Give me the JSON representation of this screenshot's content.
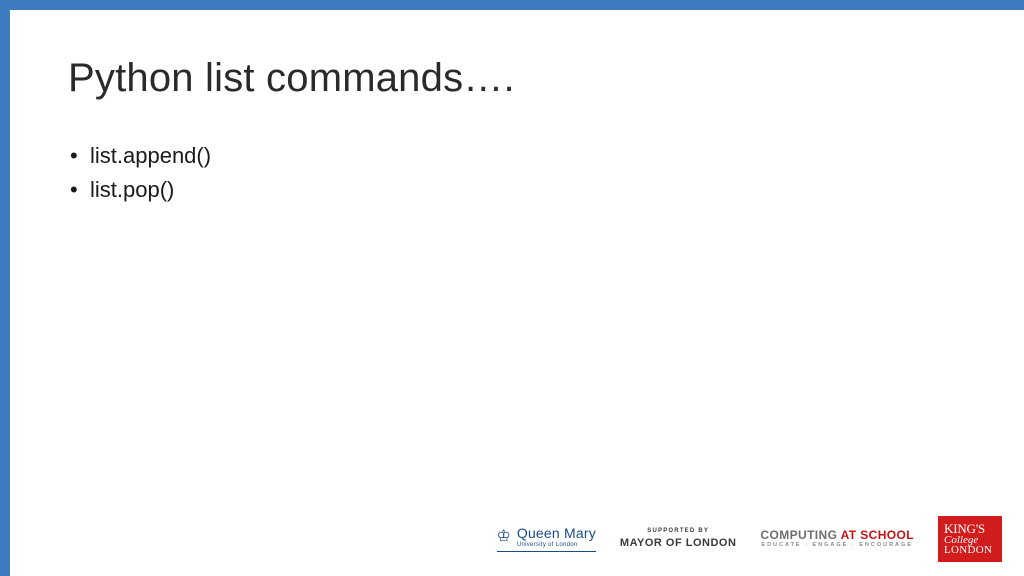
{
  "title": "Python list commands….",
  "bullets": [
    "list.append()",
    "list.pop()"
  ],
  "footer": {
    "qm": {
      "main": "Queen Mary",
      "sub": "University of London"
    },
    "mol": {
      "sup": "SUPPORTED BY",
      "main": "MAYOR OF LONDON"
    },
    "cas": {
      "word1": "COMPUTING ",
      "word2": "AT SCHOOL",
      "sub": "EDUCATE · ENGAGE · ENCOURAGE"
    },
    "kcl": {
      "l1": "KING'S",
      "l2": "College",
      "l3": "LONDON"
    }
  },
  "colors": {
    "border": "#3d7cbf",
    "kcl_bg": "#d01c1c",
    "qm": "#1a4b8c"
  }
}
